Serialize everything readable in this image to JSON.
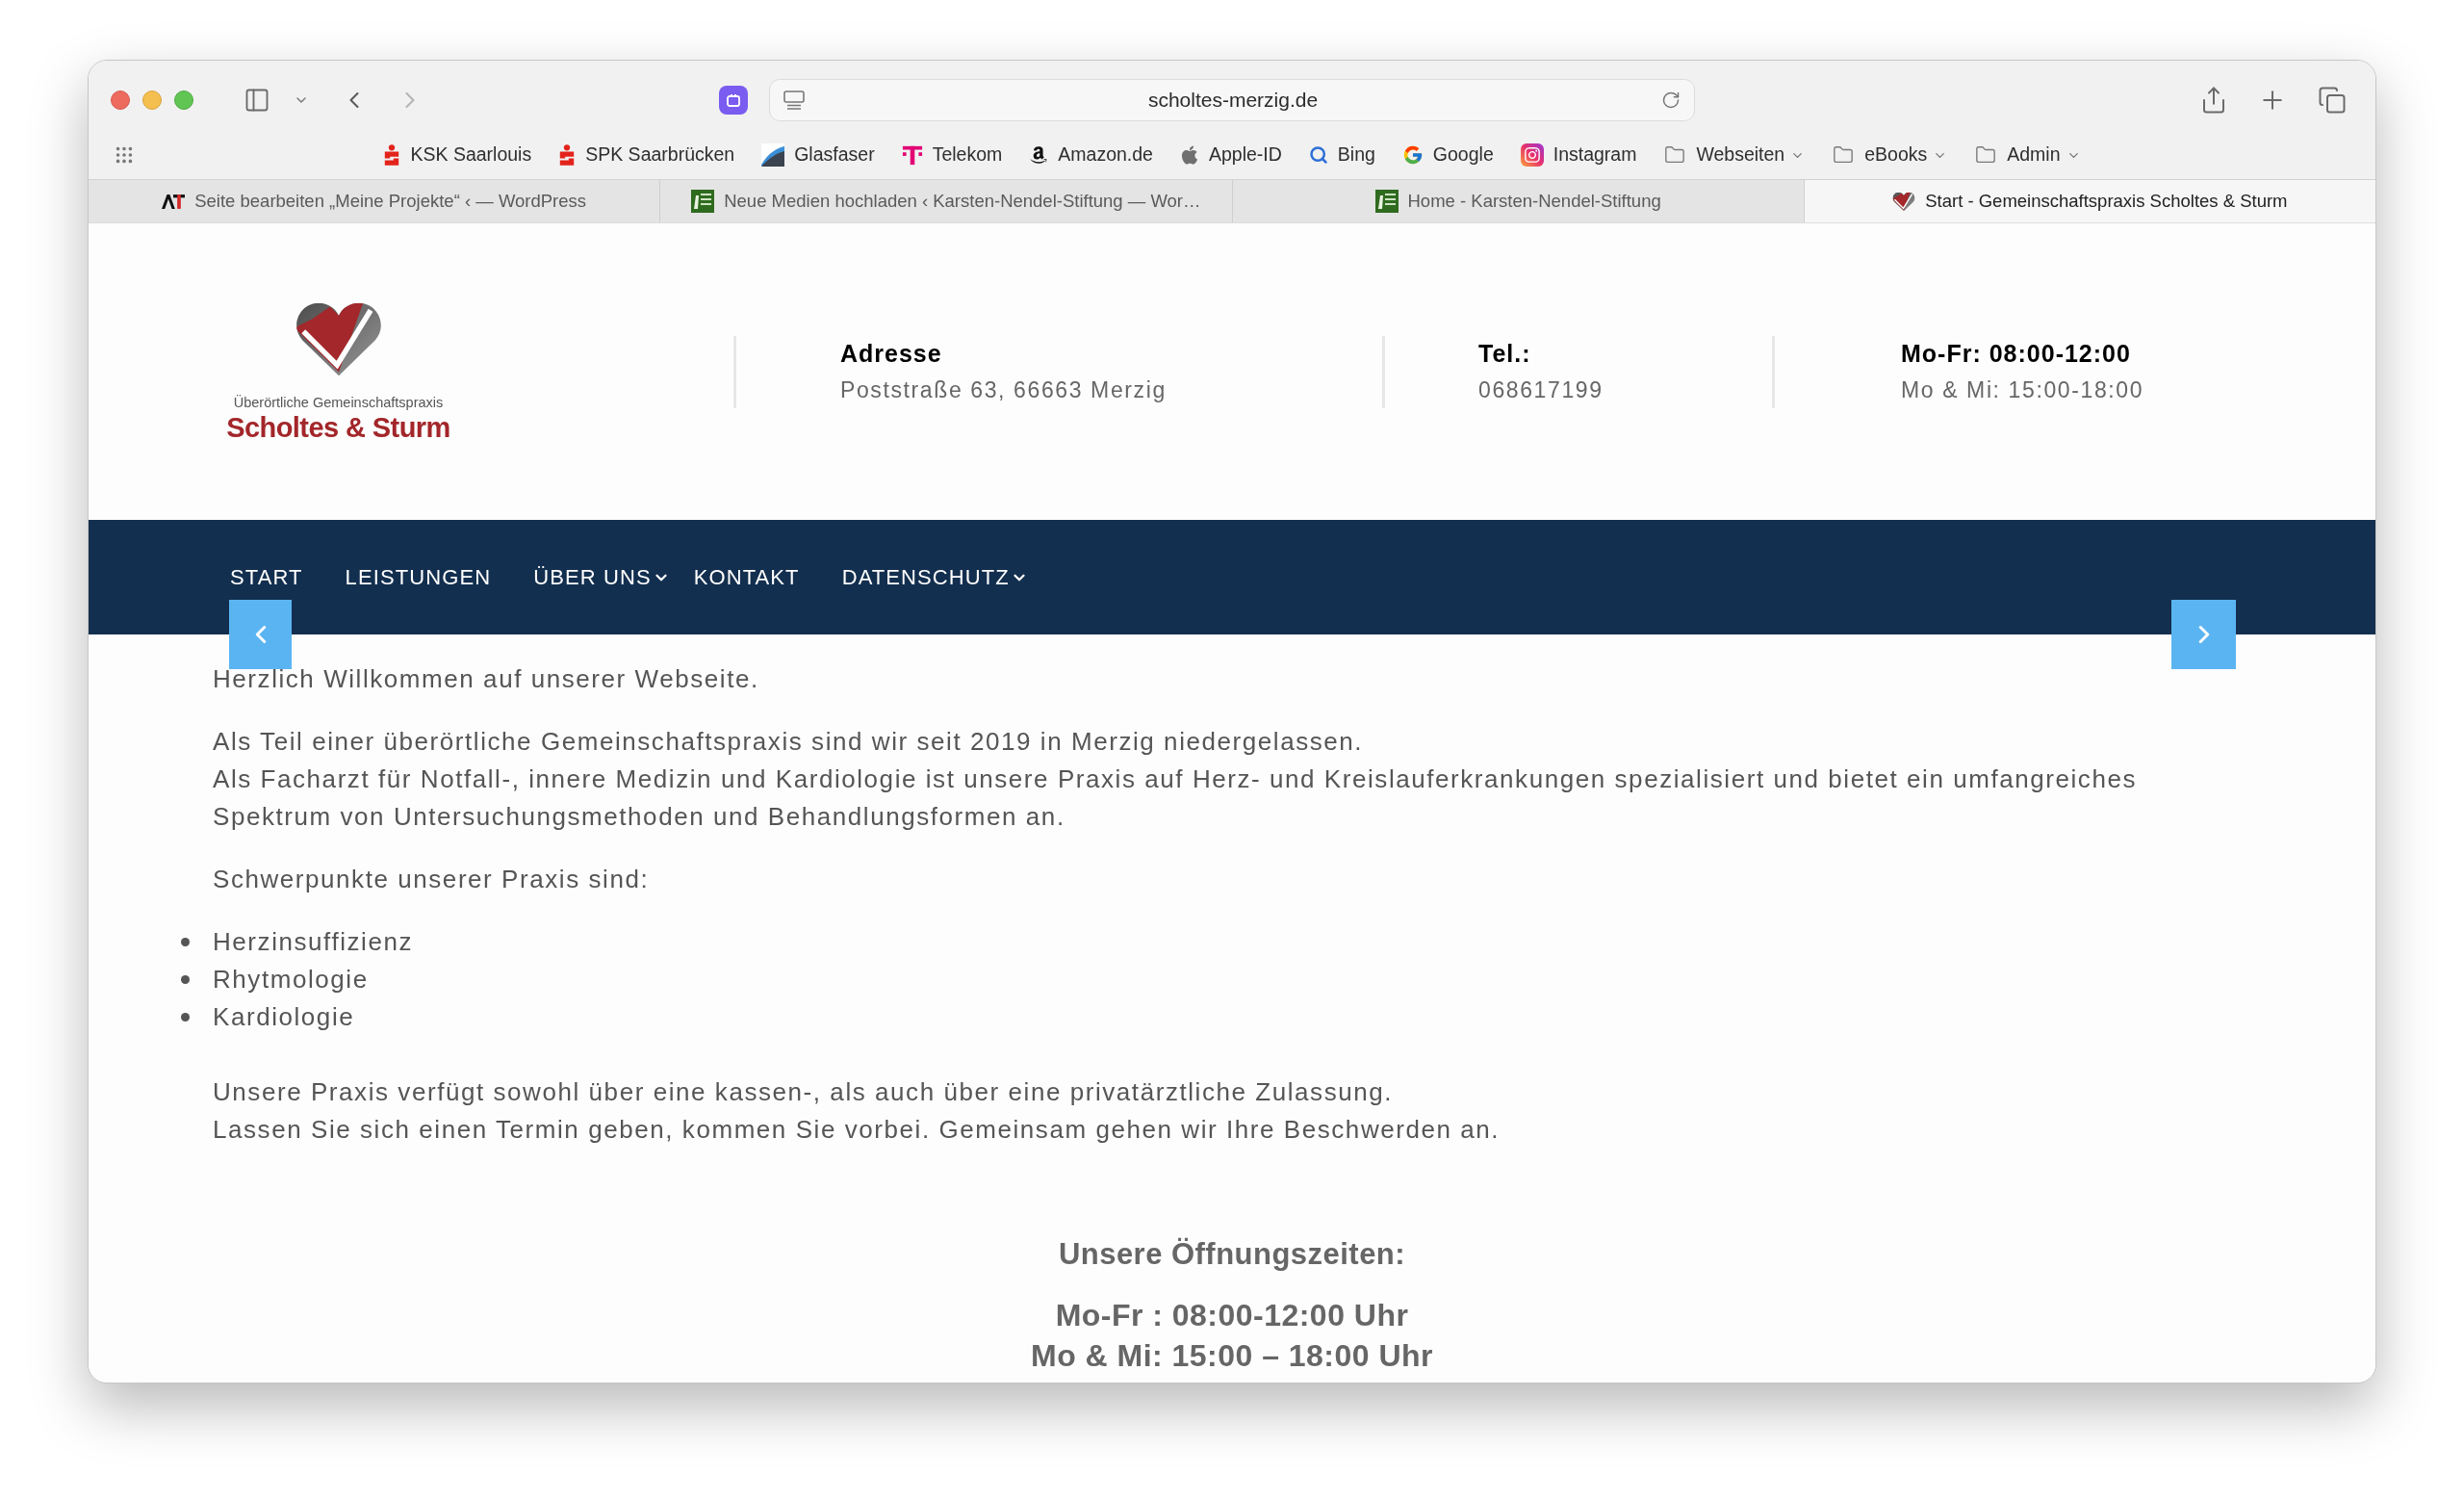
{
  "toolbar": {
    "address": "scholtes-merzig.de"
  },
  "bookmarks": [
    {
      "label": "KSK Saarlouis",
      "kind": "link"
    },
    {
      "label": "SPK Saarbrücken",
      "kind": "link"
    },
    {
      "label": "Glasfaser",
      "kind": "link"
    },
    {
      "label": "Telekom",
      "kind": "link"
    },
    {
      "label": "Amazon.de",
      "kind": "link"
    },
    {
      "label": "Apple-ID",
      "kind": "link"
    },
    {
      "label": "Bing",
      "kind": "link"
    },
    {
      "label": "Google",
      "kind": "link"
    },
    {
      "label": "Instagram",
      "kind": "link"
    },
    {
      "label": "Webseiten",
      "kind": "folder"
    },
    {
      "label": "eBooks",
      "kind": "folder"
    },
    {
      "label": "Admin",
      "kind": "folder"
    }
  ],
  "tabs": [
    {
      "title": "Seite bearbeiten „Meine Projekte“ ‹ — WordPress",
      "selected": false
    },
    {
      "title": "Neue Medien hochladen ‹ Karsten-Nendel-Stiftung — Wor…",
      "selected": false
    },
    {
      "title": "Home - Karsten-Nendel-Stiftung",
      "selected": false
    },
    {
      "title": "Start - Gemeinschaftspraxis Scholtes & Sturm",
      "selected": true
    }
  ],
  "site": {
    "logo": {
      "tagline": "Überörtliche Gemeinschaftspraxis",
      "name": "Scholtes & Sturm"
    },
    "contacts": [
      {
        "label": "Adresse",
        "value": "Poststraße 63, 66663 Merzig"
      },
      {
        "label": "Tel.:",
        "value": "068617199"
      },
      {
        "label": "Mo-Fr: 08:00-12:00",
        "value": "Mo & Mi: 15:00-18:00"
      }
    ],
    "nav": [
      {
        "label": "START",
        "dropdown": false
      },
      {
        "label": "LEISTUNGEN",
        "dropdown": false
      },
      {
        "label": "ÜBER UNS",
        "dropdown": true
      },
      {
        "label": "KONTAKT",
        "dropdown": false
      },
      {
        "label": "DATENSCHUTZ",
        "dropdown": true
      }
    ],
    "intro": "Herzlich Willkommen auf unserer Webseite.",
    "about": [
      "Als Teil einer überörtliche Gemeinschaftspraxis sind wir seit 2019 in Merzig niedergelassen.",
      "Als Facharzt für Notfall-, innere Medizin und Kardiologie ist unsere Praxis auf Herz- und Kreislauferkrankungen spezialisiert und bietet ein umfangreiches Spektrum von Untersuchungsmethoden und Behandlungsformen an."
    ],
    "focus_heading": "Schwerpunkte unserer Praxis sind:",
    "focus_list": [
      "Herzinsuffizienz",
      "Rhytmologie",
      "Kardiologie"
    ],
    "closing": [
      "Unsere Praxis verfügt sowohl über eine kassen-, als auch über eine privatärztliche Zulassung.",
      "Lassen Sie sich einen Termin geben, kommen Sie vorbei. Gemeinsam gehen wir Ihre Beschwerden an."
    ],
    "hours": {
      "title": "Unsere Öffnungszeiten:",
      "lines": [
        "Mo-Fr : 08:00-12:00 Uhr",
        "Mo & Mi: 15:00 – 18:00 Uhr"
      ]
    }
  }
}
